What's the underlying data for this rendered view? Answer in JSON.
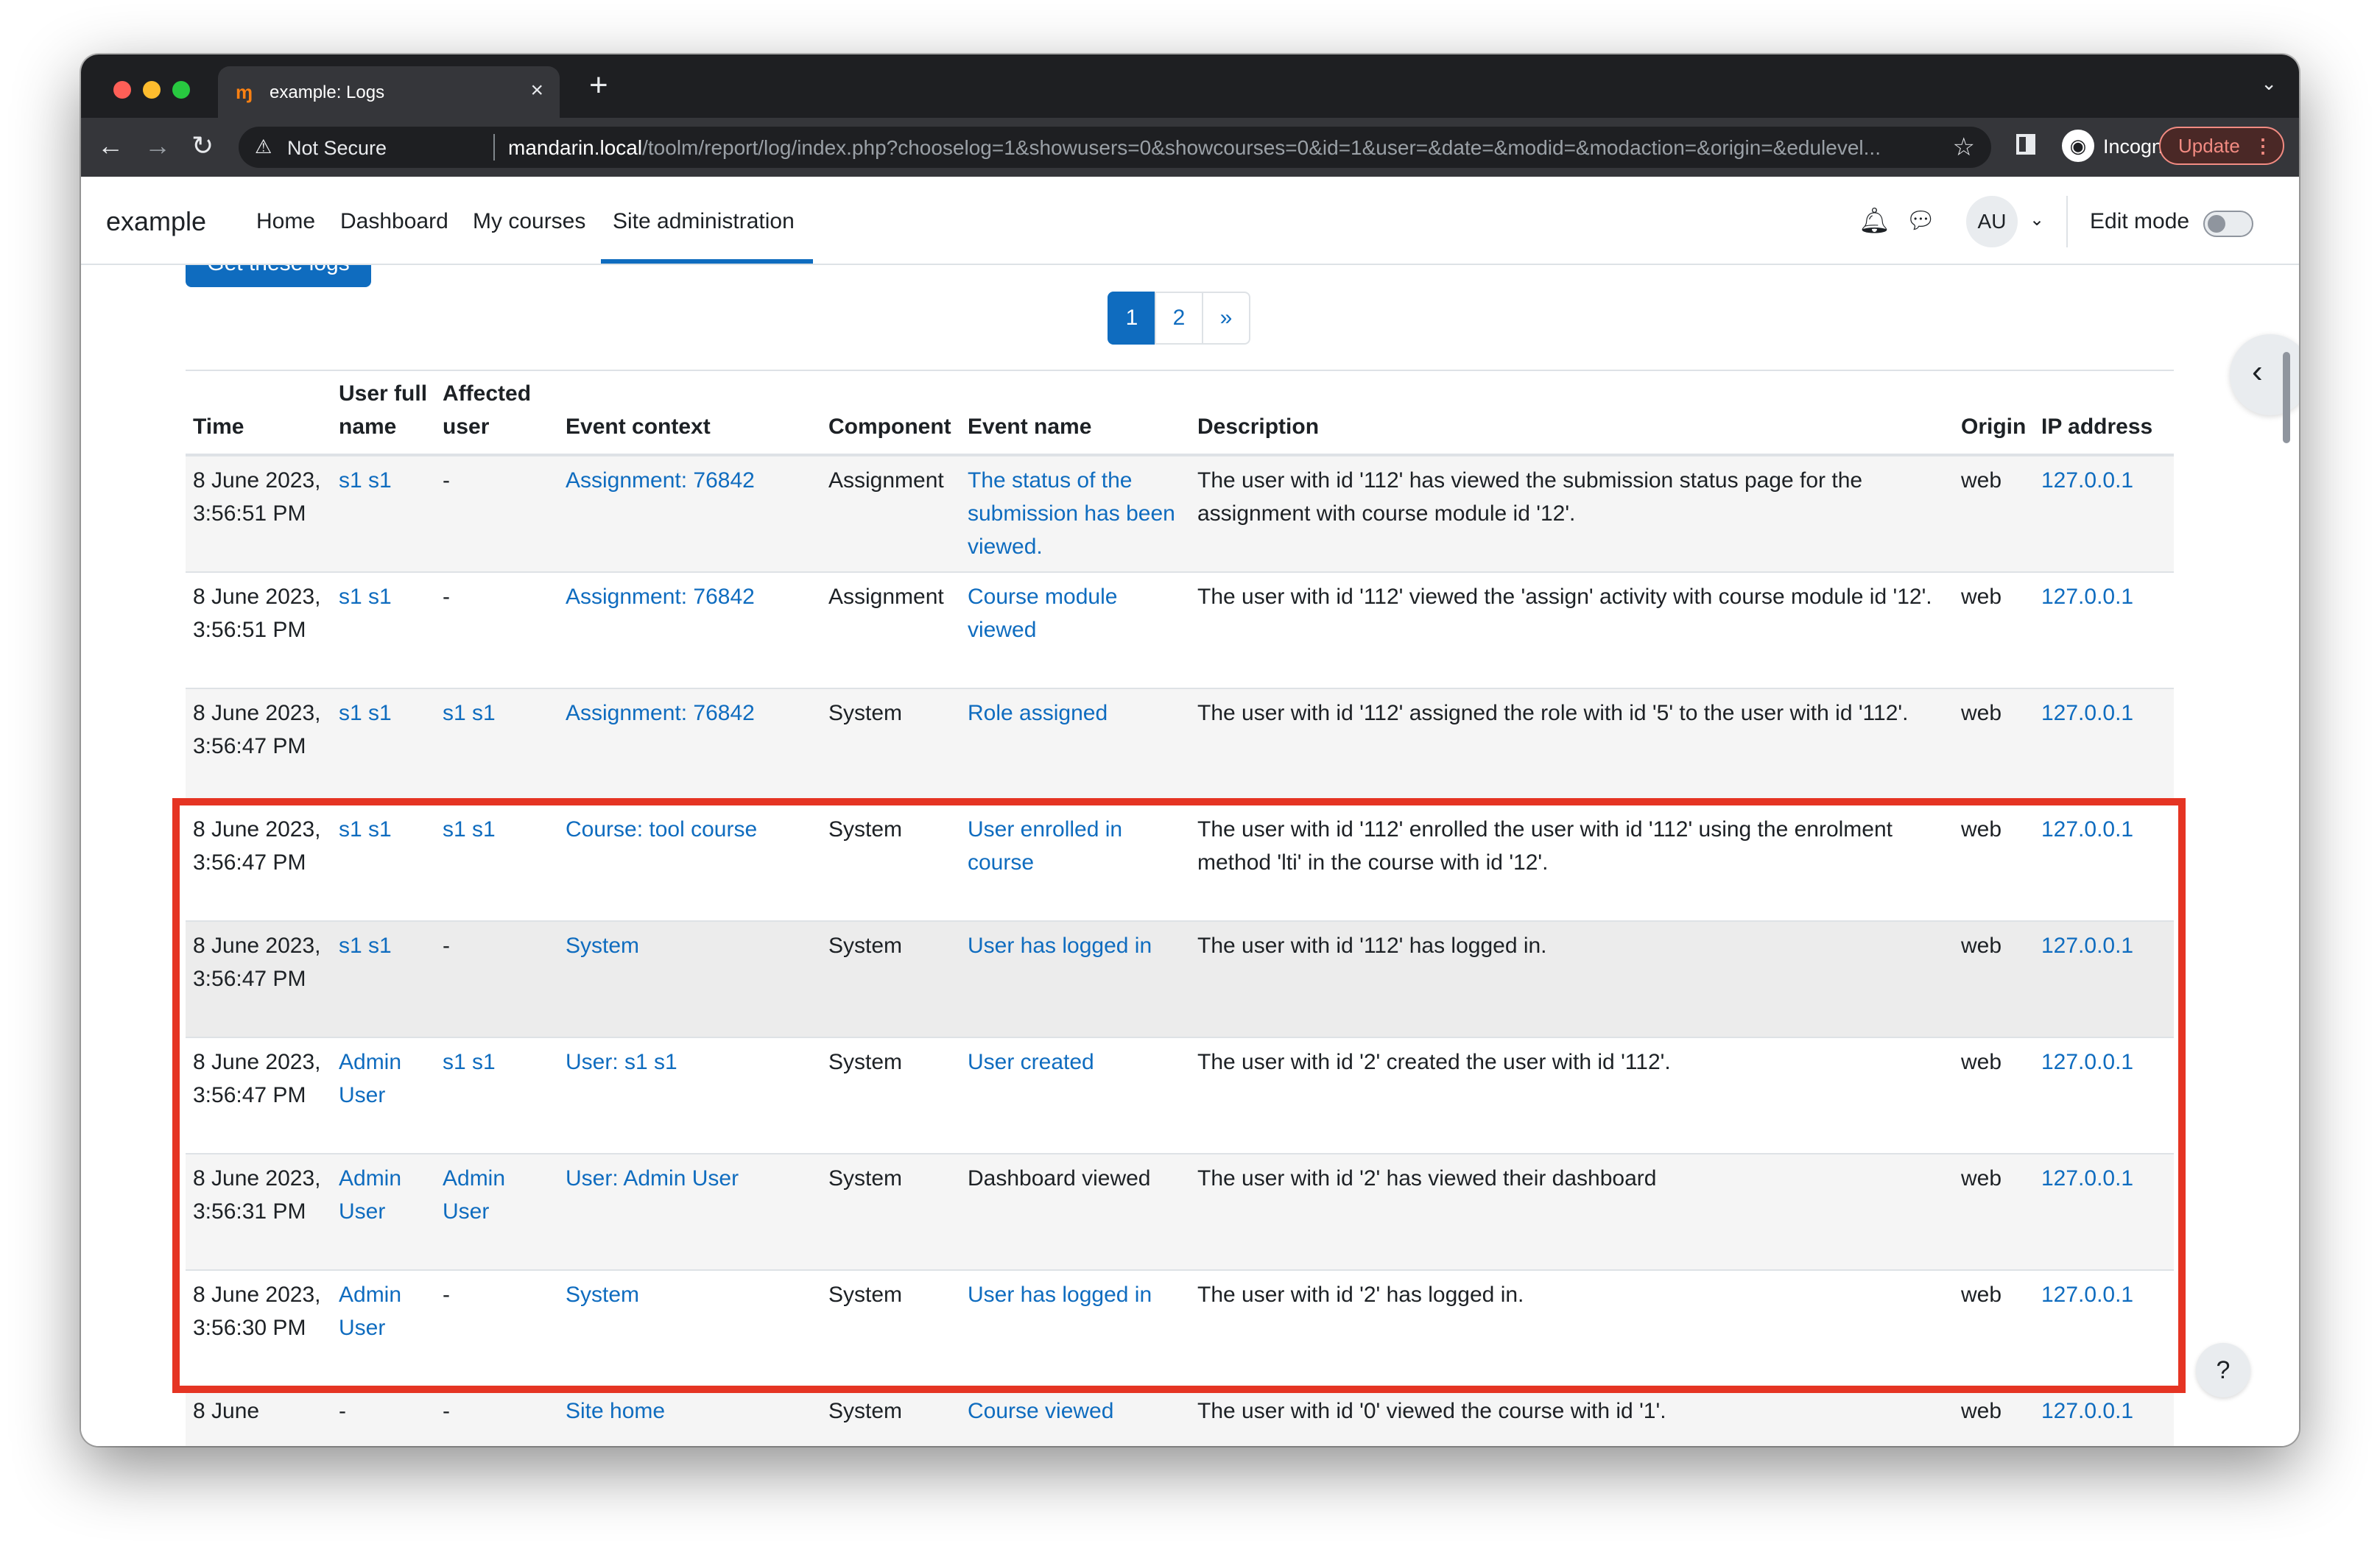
{
  "browser": {
    "tab_title": "example: Logs",
    "tab_favicon": "moodle-favicon",
    "new_tab_label": "+",
    "security_label": "Not Secure",
    "url_host": "mandarin.local",
    "url_path": "/toolm/report/log/index.php?chooselog=1&showusers=0&showcourses=0&id=1&user=&date=&modid=&modaction=&origin=&edulevel...",
    "incognito_label": "Incognito",
    "update_label": "Update"
  },
  "navbar": {
    "brand": "example",
    "links": [
      "Home",
      "Dashboard",
      "My courses",
      "Site administration"
    ],
    "active_link": "Site administration",
    "avatar_initials": "AU",
    "edit_mode_label": "Edit mode"
  },
  "content": {
    "get_logs_button": "Get these logs",
    "pagination": [
      "1",
      "2",
      "»"
    ],
    "current_page": "1",
    "help_label": "?"
  },
  "table": {
    "headers": {
      "time": "Time",
      "user_full_name": "User full name",
      "affected_user": "Affected user",
      "event_context": "Event context",
      "component": "Component",
      "event_name": "Event name",
      "description": "Description",
      "origin": "Origin",
      "ip_address": "IP address"
    },
    "rows": [
      {
        "time": "8 June 2023, 3:56:51 PM",
        "user": "s1 s1",
        "affected": "-",
        "context": "Assignment: 76842",
        "component": "Assignment",
        "event": "The status of the submission has been viewed.",
        "description": "The user with id '112' has viewed the submission status page for the assignment with course module id '12'.",
        "origin": "web",
        "ip": "127.0.0.1"
      },
      {
        "time": "8 June 2023, 3:56:51 PM",
        "user": "s1 s1",
        "affected": "-",
        "context": "Assignment: 76842",
        "component": "Assignment",
        "event": "Course module viewed",
        "description": "The user with id '112' viewed the 'assign' activity with course module id '12'.",
        "origin": "web",
        "ip": "127.0.0.1"
      },
      {
        "time": "8 June 2023, 3:56:47 PM",
        "user": "s1 s1",
        "affected": "s1 s1",
        "context": "Assignment: 76842",
        "component": "System",
        "event": "Role assigned",
        "description": "The user with id '112' assigned the role with id '5' to the user with id '112'.",
        "origin": "web",
        "ip": "127.0.0.1"
      },
      {
        "time": "8 June 2023, 3:56:47 PM",
        "user": "s1 s1",
        "affected": "s1 s1",
        "context": "Course: tool course",
        "component": "System",
        "event": "User enrolled in course",
        "description": "The user with id '112' enrolled the user with id '112' using the enrolment method 'lti' in the course with id '12'.",
        "origin": "web",
        "ip": "127.0.0.1"
      },
      {
        "time": "8 June 2023, 3:56:47 PM",
        "user": "s1 s1",
        "affected": "-",
        "context": "System",
        "component": "System",
        "event": "User has logged in",
        "description": "The user with id '112' has logged in.",
        "origin": "web",
        "ip": "127.0.0.1"
      },
      {
        "time": "8 June 2023, 3:56:47 PM",
        "user": "Admin User",
        "affected": "s1 s1",
        "context": "User: s1 s1",
        "component": "System",
        "event": "User created",
        "description": "The user with id '2' created the user with id '112'.",
        "origin": "web",
        "ip": "127.0.0.1"
      },
      {
        "time": "8 June 2023, 3:56:31 PM",
        "user": "Admin User",
        "affected": "Admin User",
        "context": "User: Admin User",
        "component": "System",
        "event": "Dashboard viewed",
        "description": "The user with id '2' has viewed their dashboard",
        "origin": "web",
        "ip": "127.0.0.1"
      },
      {
        "time": "8 June 2023, 3:56:30 PM",
        "user": "Admin User",
        "affected": "-",
        "context": "System",
        "component": "System",
        "event": "User has logged in",
        "description": "The user with id '2' has logged in.",
        "origin": "web",
        "ip": "127.0.0.1"
      },
      {
        "time": "8 June",
        "user": "-",
        "affected": "-",
        "context": "Site home",
        "component": "System",
        "event": "Course viewed",
        "description": "The user with id '0' viewed the course with id '1'.",
        "origin": "web",
        "ip": "127.0.0.1"
      }
    ]
  },
  "colors": {
    "accent": "#0f6cbf",
    "highlight": "#e53423",
    "chrome_dark": "#1e1f22"
  }
}
